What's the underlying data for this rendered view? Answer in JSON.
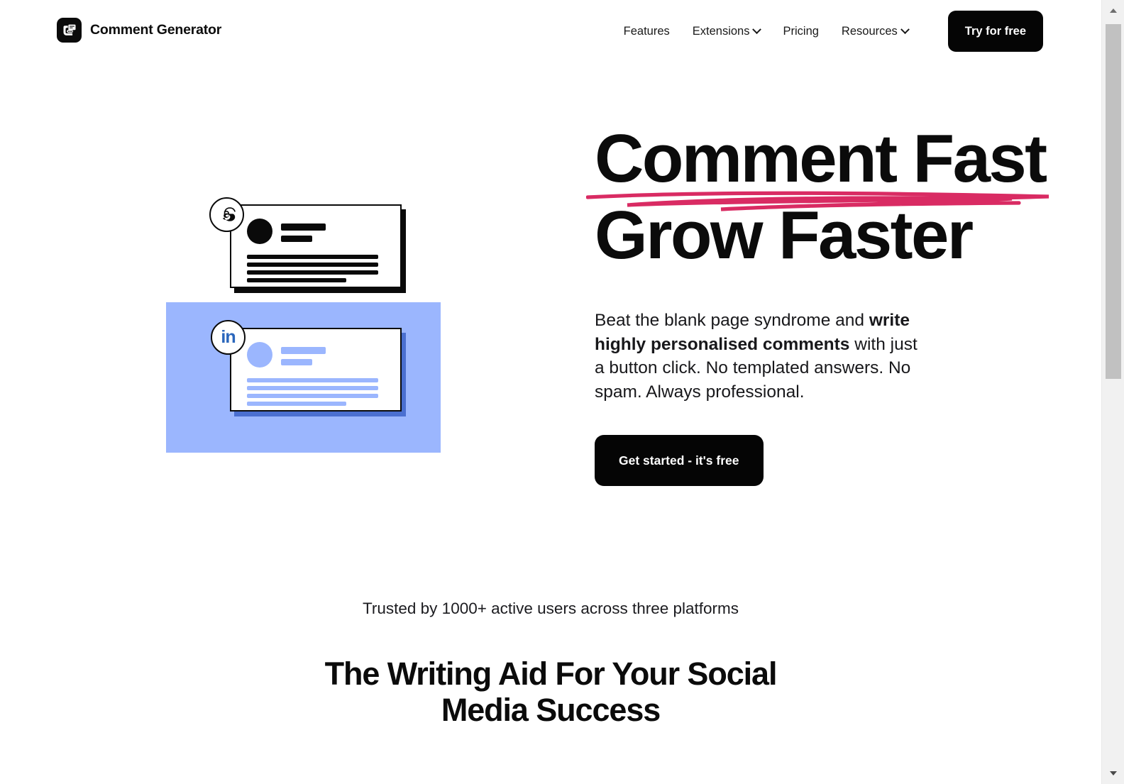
{
  "brand": {
    "name": "Comment Generator",
    "logo_icon": "chat-bubble-logo-icon",
    "logo_bg": "#0b0b0b"
  },
  "nav": {
    "items": [
      {
        "label": "Features",
        "has_dropdown": false
      },
      {
        "label": "Extensions",
        "has_dropdown": true
      },
      {
        "label": "Pricing",
        "has_dropdown": false
      },
      {
        "label": "Resources",
        "has_dropdown": true
      }
    ],
    "cta_label": "Try for free"
  },
  "hero": {
    "headline_line1": "Comment Fast",
    "headline_line2": "Grow Faster",
    "underline_color": "#d92b63",
    "subtext": {
      "part1": "Beat the blank page syndrome and ",
      "bold": "write highly personalised comments",
      "part2": " with just a button click. No templated answers. No spam. Always professional."
    },
    "cta_label": "Get started - it's free"
  },
  "illustration": {
    "panel_color": "#9bb6fe",
    "card_threads": {
      "badge_icon": "threads-icon",
      "accent": "#0a0a0a"
    },
    "card_linkedin": {
      "badge_icon": "linkedin-icon",
      "badge_text": "in",
      "badge_color": "#2a66bc",
      "accent": "#9bb6fe"
    }
  },
  "social_proof": {
    "text": "Trusted by 1000+ active users across three platforms"
  },
  "section": {
    "title_line1": "The Writing Aid For Your Social",
    "title_line2": "Media Success"
  },
  "scrollbar": {
    "up_icon": "scroll-up-arrow-icon",
    "down_icon": "scroll-down-arrow-icon"
  }
}
